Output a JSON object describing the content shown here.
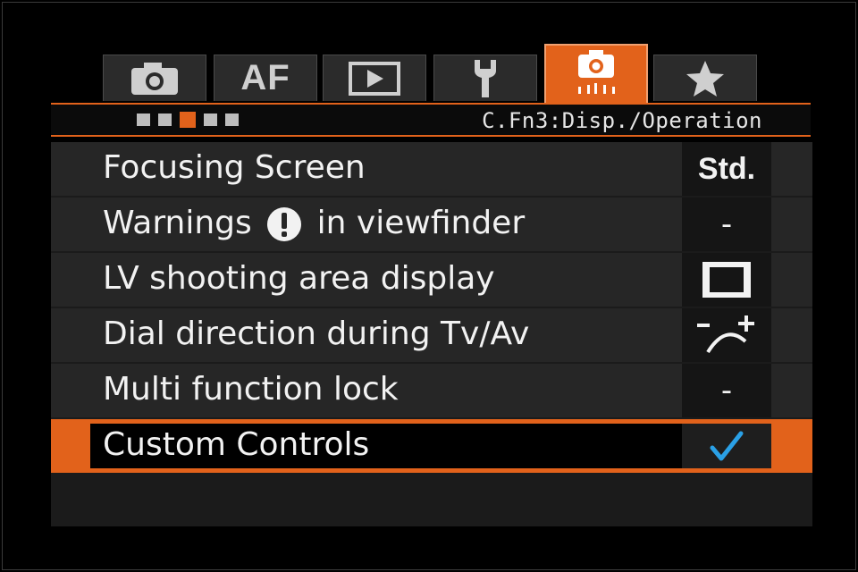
{
  "tabs": [
    {
      "name": "camera-icon",
      "label": ""
    },
    {
      "name": "af-tab",
      "label": "AF"
    },
    {
      "name": "playback-icon",
      "label": ""
    },
    {
      "name": "wrench-icon",
      "label": ""
    },
    {
      "name": "custom-functions-icon",
      "label": ""
    },
    {
      "name": "star-icon",
      "label": ""
    }
  ],
  "active_tab_index": 4,
  "header": {
    "page_title": "C.Fn3:Disp./Operation",
    "page_count": 5,
    "active_page_index": 2
  },
  "menu": {
    "items": [
      {
        "label": "Focusing Screen",
        "value": "Std."
      },
      {
        "label_before": "Warnings",
        "label_after": "in viewfinder",
        "value": "-"
      },
      {
        "label": "LV shooting area display",
        "value_icon": "frame-rectangle-icon"
      },
      {
        "label": "Dial direction during Tv/Av",
        "value_icon": "dial-direction-icon"
      },
      {
        "label": "Multi function lock",
        "value": "-"
      },
      {
        "label": "Custom Controls",
        "value_icon": "checkmark-icon"
      }
    ],
    "selected_index": 5
  },
  "colors": {
    "accent": "#e2621b",
    "checkmark": "#2aa0e6",
    "text": "#f2f2f2"
  }
}
